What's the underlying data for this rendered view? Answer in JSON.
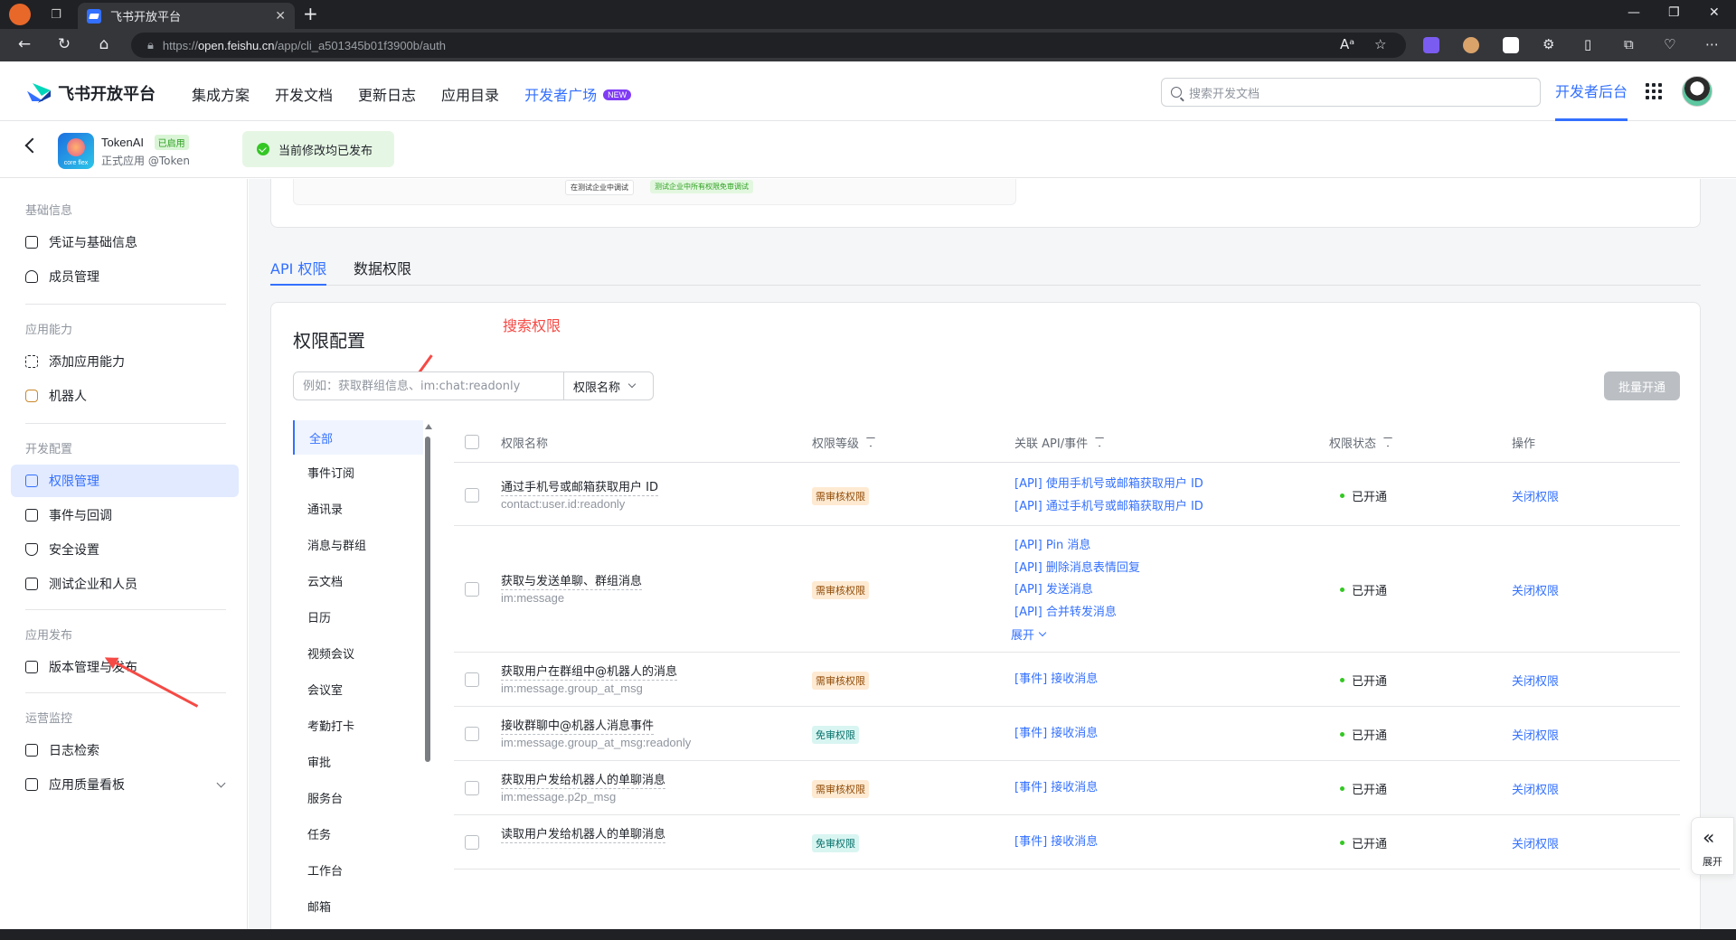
{
  "browser": {
    "tab_title": "飞书开放平台",
    "url_prefix": "https://",
    "url_host": "open.feishu.cn",
    "url_path": "/app/cli_a501345b01f3900b/auth"
  },
  "header": {
    "logo_text": "飞书开放平台",
    "nav": [
      "集成方案",
      "开发文档",
      "更新日志",
      "应用目录",
      "开发者广场"
    ],
    "new_badge": "NEW",
    "search_placeholder": "搜索开发文档",
    "console": "开发者后台"
  },
  "app": {
    "name": "TokenAI",
    "status": "已启用",
    "subtitle": "正式应用 @Token",
    "icon_text": "core flex",
    "toast": "当前修改均已发布"
  },
  "sidebar": {
    "groups": [
      {
        "title": "基础信息",
        "items": [
          "凭证与基础信息",
          "成员管理"
        ]
      },
      {
        "title": "应用能力",
        "items": [
          "添加应用能力",
          "机器人"
        ]
      },
      {
        "title": "开发配置",
        "items": [
          "权限管理",
          "事件与回调",
          "安全设置",
          "测试企业和人员"
        ]
      },
      {
        "title": "应用发布",
        "items": [
          "版本管理与发布"
        ]
      },
      {
        "title": "运营监控",
        "items": [
          "日志检索",
          "应用质量看板"
        ]
      }
    ]
  },
  "mini_panel": {
    "tag1": "在测试企业中调试",
    "tag2": "测试企业中所有权限免审调试"
  },
  "tabs": [
    "API 权限",
    "数据权限"
  ],
  "perm": {
    "title": "权限配置",
    "annotation": "搜索权限",
    "search_placeholder": "例如：获取群组信息、im:chat:readonly",
    "select_value": "权限名称",
    "batch_button": "批量开通",
    "categories": [
      "全部",
      "事件订阅",
      "通讯录",
      "消息与群组",
      "云文档",
      "日历",
      "视频会议",
      "会议室",
      "考勤打卡",
      "审批",
      "服务台",
      "任务",
      "工作台",
      "邮箱"
    ],
    "columns": [
      "权限名称",
      "权限等级",
      "关联 API/事件",
      "权限状态",
      "操作"
    ],
    "rows": [
      {
        "name": "通过手机号或邮箱获取用户 ID",
        "code": "contact:user.id:readonly",
        "level": "需审核权限",
        "apis": [
          "[API] 使用手机号或邮箱获取用户 ID",
          "[API] 通过手机号或邮箱获取用户 ID"
        ],
        "status": "已开通",
        "op": "关闭权限"
      },
      {
        "name": "获取与发送单聊、群组消息",
        "code": "im:message",
        "level": "需审核权限",
        "apis": [
          "[API] Pin 消息",
          "[API] 删除消息表情回复",
          "[API] 发送消息",
          "[API] 合并转发消息"
        ],
        "more": "展开",
        "status": "已开通",
        "op": "关闭权限"
      },
      {
        "name": "获取用户在群组中@机器人的消息",
        "code": "im:message.group_at_msg",
        "level": "需审核权限",
        "apis": [
          "[事件] 接收消息"
        ],
        "status": "已开通",
        "op": "关闭权限"
      },
      {
        "name": "接收群聊中@机器人消息事件",
        "code": "im:message.group_at_msg:readonly",
        "level": "免审权限",
        "apis": [
          "[事件] 接收消息"
        ],
        "status": "已开通",
        "op": "关闭权限"
      },
      {
        "name": "获取用户发给机器人的单聊消息",
        "code": "im:message.p2p_msg",
        "level": "需审核权限",
        "apis": [
          "[事件] 接收消息"
        ],
        "status": "已开通",
        "op": "关闭权限"
      },
      {
        "name": "读取用户发给机器人的单聊消息",
        "code": "",
        "level": "免审权限",
        "apis": [
          "[事件] 接收消息"
        ],
        "status": "已开通",
        "op": "关闭权限"
      }
    ]
  },
  "expand": "展开"
}
